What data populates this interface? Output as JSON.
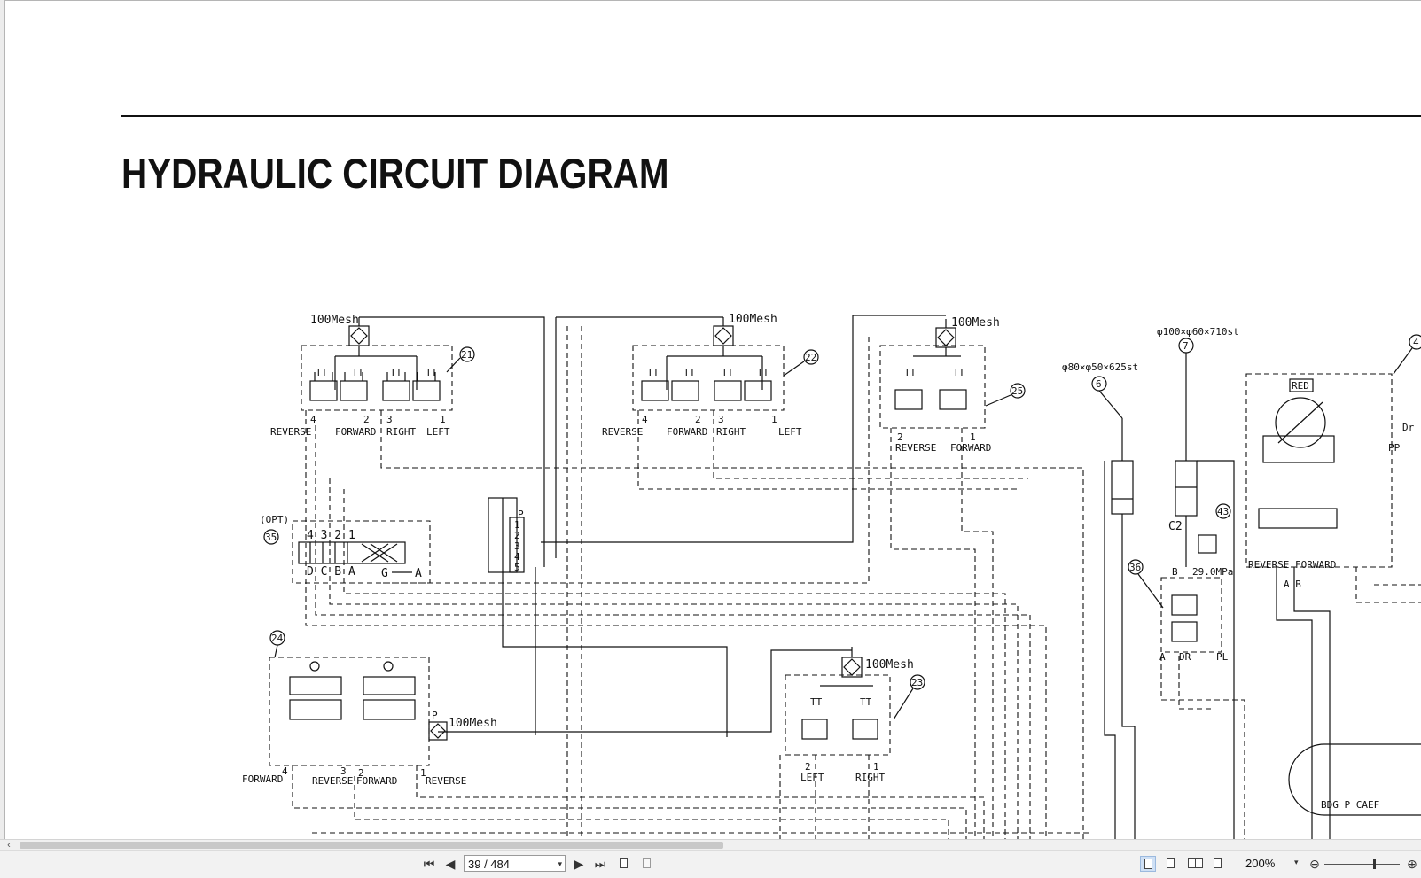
{
  "document": {
    "title": "HYDRAULIC CIRCUIT DIAGRAM"
  },
  "diagram": {
    "component_numbers": [
      "21",
      "22",
      "25",
      "35",
      "24",
      "23",
      "6",
      "7",
      "43",
      "36",
      "4"
    ],
    "mesh_label": "100Mesh",
    "cyl_6_spec": "φ80×φ50×625st",
    "cyl_7_spec": "φ100×φ60×710st",
    "opt_label": "(OPT)",
    "pressure_label": "29.0MPa",
    "red_label": "RED",
    "labels": {
      "reverse": "REVERSE",
      "forward": "FORWARD",
      "right": "RIGHT",
      "left": "LEFT",
      "reverse_forward": "REVERSE FORWARD",
      "c2": "C2",
      "b": "B",
      "a": "A",
      "dr": "DR",
      "pl": "PL",
      "p": "P",
      "pp": "PP",
      "dr_short": "Dr",
      "ab": "A B",
      "port_letters": "BDG P CAEF",
      "valve_35_top": "4 3 2 1",
      "valve_35_bottom": "D C B A",
      "valve_35_ga": "G",
      "valve_35_a": "A",
      "n1": "1",
      "n2": "2",
      "n3": "3",
      "n4": "4",
      "block_ports": [
        "1",
        "2",
        "3",
        "4",
        "5",
        "6"
      ]
    }
  },
  "scrollbar": {
    "left_arrow": "‹"
  },
  "toolbar": {
    "first_page": "⏮",
    "prev_page": "◀",
    "page_indicator": "39 / 484",
    "next_page": "▶",
    "last_page": "⏭",
    "zoom": "200%",
    "zoom_dropdown": "▾",
    "page_dropdown": "▾",
    "zoom_out": "⊖",
    "zoom_in": "⊕",
    "zoom_level": 0.66
  }
}
